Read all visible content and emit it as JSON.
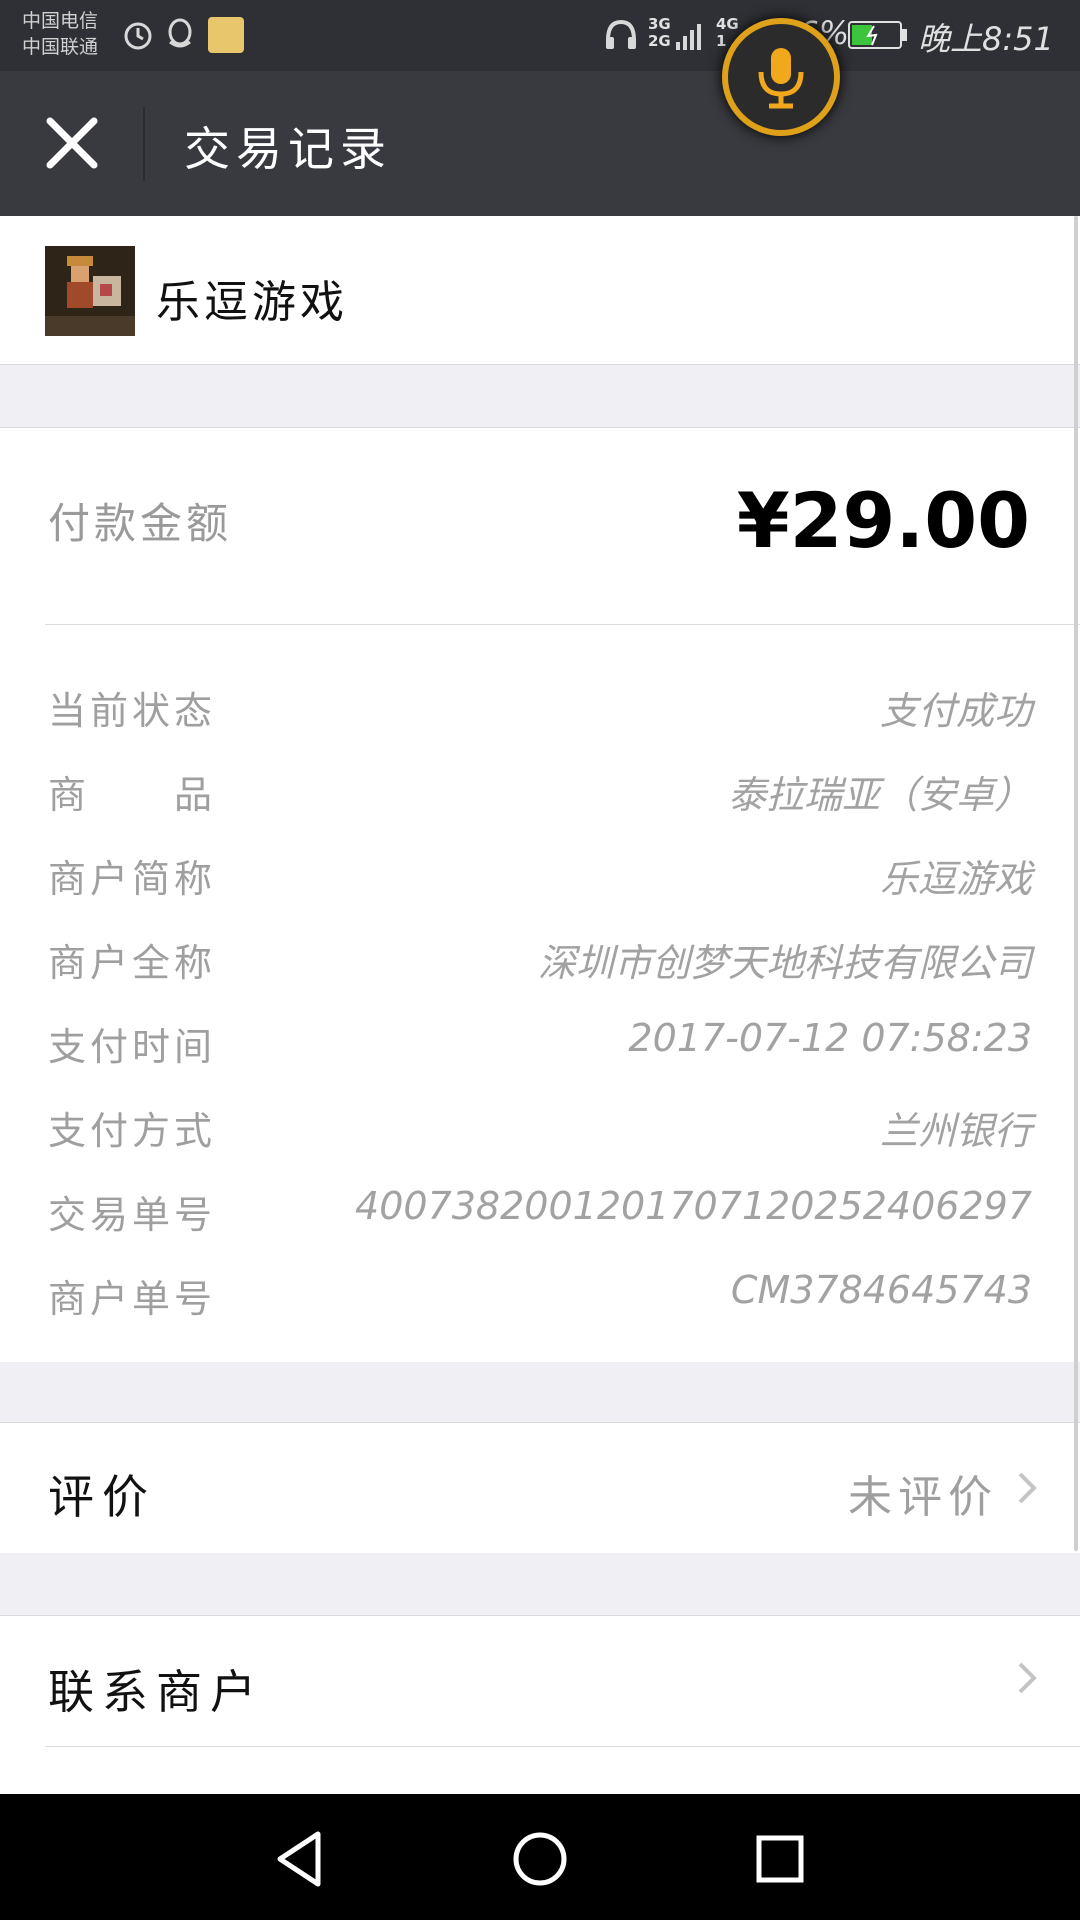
{
  "status_bar": {
    "carrier_1": "中国电信",
    "carrier_2": "中国联通",
    "net_a_top": "3G",
    "net_a_bottom": "2G",
    "net_b_top": "4G",
    "net_b_bottom": "1",
    "battery": "36%",
    "time": "晚上8:51",
    "icons": [
      "alarm-icon",
      "qq-icon",
      "app-icon",
      "headphone-icon",
      "signal-icon",
      "battery-icon"
    ]
  },
  "header": {
    "title": "交易记录",
    "close_icon": "close-icon",
    "voice_icon": "microphone-icon"
  },
  "merchant": {
    "name": "乐逗游戏"
  },
  "amount": {
    "label": "付款金额",
    "value": "¥29.00"
  },
  "details": [
    {
      "label": "当前状态",
      "value": "支付成功"
    },
    {
      "label": "商　　品",
      "value": "泰拉瑞亚（安卓）"
    },
    {
      "label": "商户简称",
      "value": "乐逗游戏"
    },
    {
      "label": "商户全称",
      "value": "深圳市创梦天地科技有限公司"
    },
    {
      "label": "支付时间",
      "value": "2017-07-12 07:58:23"
    },
    {
      "label": "支付方式",
      "value": "兰州银行"
    },
    {
      "label": "交易单号",
      "value": "4007382001201707120252406297"
    },
    {
      "label": "商户单号",
      "value": "CM3784645743"
    }
  ],
  "rating": {
    "label": "评价",
    "value": "未评价"
  },
  "contact": {
    "label": "联系商户"
  },
  "colors": {
    "status_bar": "#2e3035",
    "title_bar": "#393a3f",
    "page_bg": "#efeff4",
    "voice_ring": "#e0a11a"
  },
  "nav": {
    "icons": [
      "back-icon",
      "home-icon",
      "recents-icon"
    ]
  }
}
